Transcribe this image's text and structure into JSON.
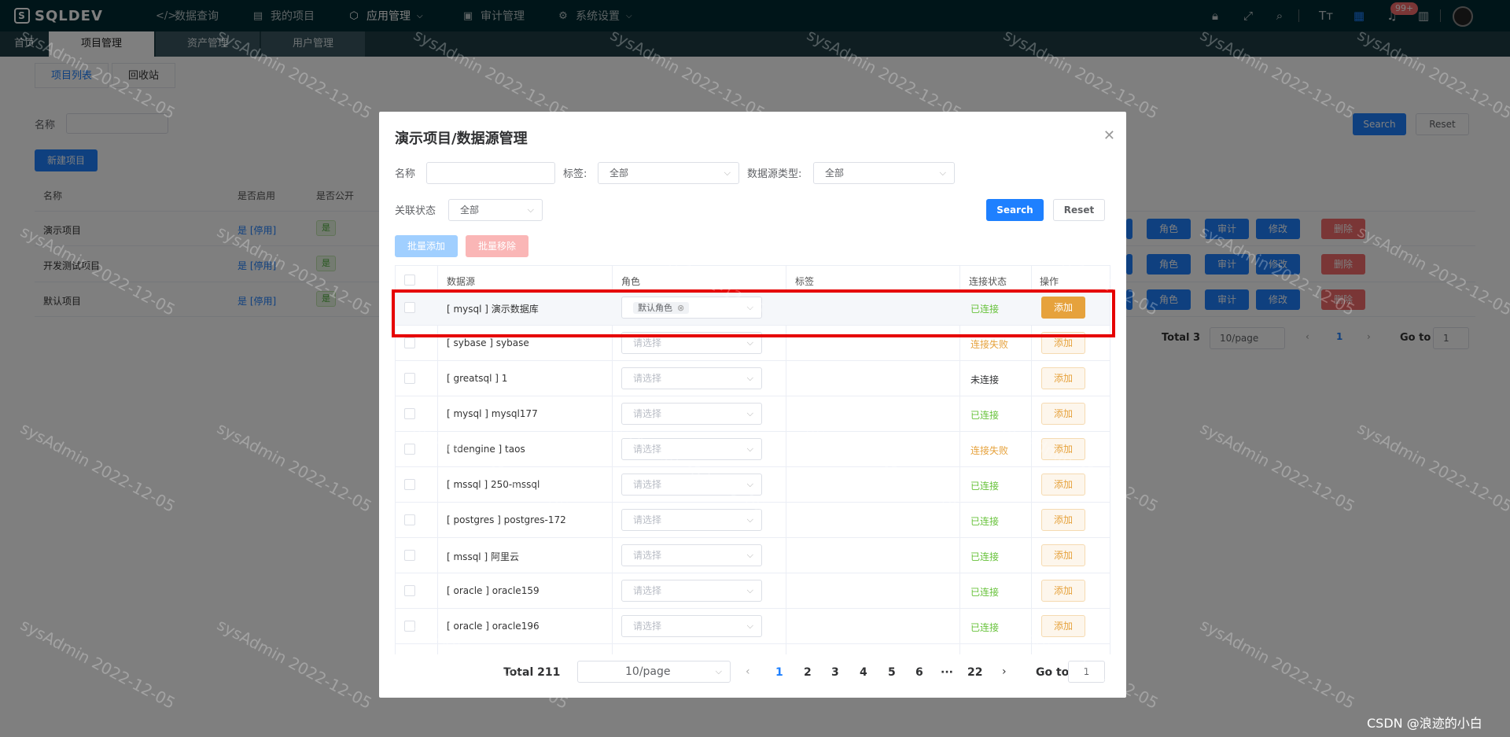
{
  "app": {
    "name": "SQLDEV"
  },
  "nav": [
    {
      "label": "数据查询",
      "icon": "code-icon"
    },
    {
      "label": "我的项目",
      "icon": "book-icon"
    },
    {
      "label": "应用管理",
      "icon": "cube-icon"
    },
    {
      "label": "审计管理",
      "icon": "audit-icon"
    },
    {
      "label": "系统设置",
      "icon": "gear-icon"
    }
  ],
  "notifications": {
    "badge": "99+"
  },
  "page_tabs": [
    "首页",
    "项目管理",
    "资产管理",
    "用户管理"
  ],
  "sub_tabs": [
    "项目列表",
    "回收站"
  ],
  "filter": {
    "name_label": "名称",
    "search": "Search",
    "reset": "Reset"
  },
  "new_button": "新建项目",
  "bg_table": {
    "headers": [
      "名称",
      "是否启用",
      "是否公开"
    ],
    "rows": [
      {
        "name": "演示项目",
        "enabled": "是 [停用]",
        "public": "是"
      },
      {
        "name": "开发测试项目",
        "enabled": "是 [停用]",
        "public": "是"
      },
      {
        "name": "默认项目",
        "enabled": "是 [停用]",
        "public": "是"
      }
    ],
    "actions": [
      "角色",
      "审计",
      "修改",
      "删除"
    ],
    "pagination": {
      "total": "Total 3",
      "page_size": "10/page",
      "page": "1",
      "goto_label": "Go to",
      "goto_value": "1"
    }
  },
  "dialog": {
    "title": "演示项目/数据源管理",
    "filters": {
      "name_label": "名称",
      "tag_label": "标签:",
      "tag_value": "全部",
      "type_label": "数据源类型:",
      "type_value": "全部",
      "status_label": "关联状态",
      "status_value": "全部"
    },
    "search": "Search",
    "reset": "Reset",
    "batch_add": "批量添加",
    "batch_remove": "批量移除",
    "headers": [
      "数据源",
      "角色",
      "标签",
      "连接状态",
      "操作"
    ],
    "rows": [
      {
        "source": "[ mysql ] 演示数据库",
        "role": "默认角色",
        "status": "已连接",
        "status_color": "#67c23a",
        "action": "添加"
      },
      {
        "source": "[ sybase ] sybase",
        "role": "请选择",
        "status": "连接失败",
        "status_color": "#e6a23c",
        "action": "添加"
      },
      {
        "source": "[ greatsql ] 1",
        "role": "请选择",
        "status": "未连接",
        "status_color": "#303133",
        "action": "添加"
      },
      {
        "source": "[ mysql ] mysql177",
        "role": "请选择",
        "status": "已连接",
        "status_color": "#67c23a",
        "action": "添加"
      },
      {
        "source": "[ tdengine ] taos",
        "role": "请选择",
        "status": "连接失败",
        "status_color": "#e6a23c",
        "action": "添加"
      },
      {
        "source": "[ mssql ] 250-mssql",
        "role": "请选择",
        "status": "已连接",
        "status_color": "#67c23a",
        "action": "添加"
      },
      {
        "source": "[ postgres ] postgres-172",
        "role": "请选择",
        "status": "已连接",
        "status_color": "#67c23a",
        "action": "添加"
      },
      {
        "source": "[ mssql ] 阿里云",
        "role": "请选择",
        "status": "已连接",
        "status_color": "#67c23a",
        "action": "添加"
      },
      {
        "source": "[ oracle ] oracle159",
        "role": "请选择",
        "status": "已连接",
        "status_color": "#67c23a",
        "action": "添加"
      },
      {
        "source": "[ oracle ] oracle196",
        "role": "请选择",
        "status": "已连接",
        "status_color": "#67c23a",
        "action": "添加"
      }
    ],
    "pagination": {
      "total": "Total 211",
      "page_size": "10/page",
      "pages": [
        "1",
        "2",
        "3",
        "4",
        "5",
        "6",
        "···",
        "22"
      ],
      "current": "1",
      "goto_label": "Go to",
      "goto_value": "1"
    }
  },
  "watermark": "sysAdmin 2022-12-05",
  "credit": "CSDN @浪迹的小白",
  "colors": {
    "primary": "#1e80ff",
    "topbar": "#002b33",
    "warning": "#e6a23c",
    "success": "#67c23a",
    "danger": "#f56c6c",
    "highlight_box": "#e60000"
  }
}
